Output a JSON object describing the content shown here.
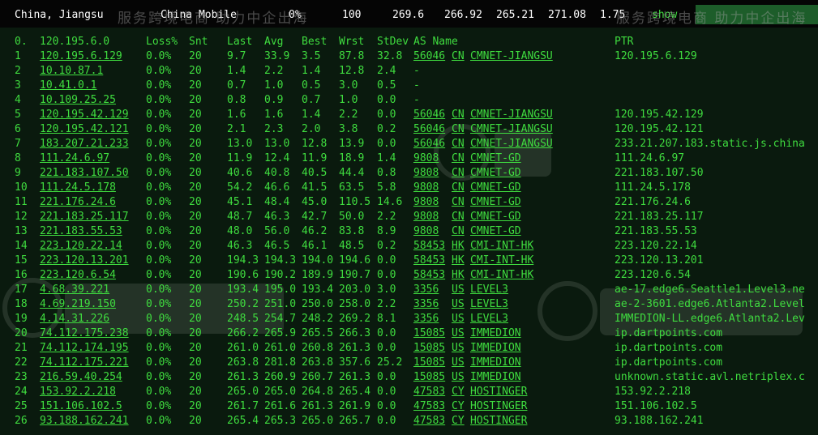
{
  "topbar": {
    "location": "China, Jiangsu",
    "isp": "China Mobile",
    "loss": "0%",
    "count": "100",
    "v1": "269.6",
    "v2": "266.92",
    "v3": "265.21",
    "v4": "271.08",
    "v5": "1.75",
    "show_label": "show"
  },
  "watermark": {
    "text_top": "服务跨境电商 助力中企出海"
  },
  "header": {
    "num": "0.",
    "host": "120.195.6.0",
    "loss": "Loss%",
    "snt": "Snt",
    "last": "Last",
    "avg": "Avg",
    "best": "Best",
    "wrst": "Wrst",
    "stdev": "StDev",
    "asname": "AS Name",
    "ptr": "PTR"
  },
  "rows": [
    {
      "n": "1",
      "host": "120.195.6.129",
      "loss": "0.0%",
      "snt": "20",
      "last": "9.7",
      "avg": "33.9",
      "best": "3.5",
      "wrst": "87.8",
      "stdev": "32.8",
      "as": "56046",
      "cc": "CN",
      "asname": "CMNET-JIANGSU",
      "ptr": "120.195.6.129"
    },
    {
      "n": "2",
      "host": "10.10.87.1",
      "loss": "0.0%",
      "snt": "20",
      "last": "1.4",
      "avg": "2.2",
      "best": "1.4",
      "wrst": "12.8",
      "stdev": "2.4",
      "as": "-",
      "cc": "",
      "asname": "",
      "ptr": ""
    },
    {
      "n": "3",
      "host": "10.41.0.1",
      "loss": "0.0%",
      "snt": "20",
      "last": "0.7",
      "avg": "1.0",
      "best": "0.5",
      "wrst": "3.0",
      "stdev": "0.5",
      "as": "-",
      "cc": "",
      "asname": "",
      "ptr": ""
    },
    {
      "n": "4",
      "host": "10.109.25.25",
      "loss": "0.0%",
      "snt": "20",
      "last": "0.8",
      "avg": "0.9",
      "best": "0.7",
      "wrst": "1.0",
      "stdev": "0.0",
      "as": "-",
      "cc": "",
      "asname": "",
      "ptr": ""
    },
    {
      "n": "5",
      "host": "120.195.42.129",
      "loss": "0.0%",
      "snt": "20",
      "last": "1.6",
      "avg": "1.6",
      "best": "1.4",
      "wrst": "2.2",
      "stdev": "0.0",
      "as": "56046",
      "cc": "CN",
      "asname": "CMNET-JIANGSU",
      "ptr": "120.195.42.129"
    },
    {
      "n": "6",
      "host": "120.195.42.121",
      "loss": "0.0%",
      "snt": "20",
      "last": "2.1",
      "avg": "2.3",
      "best": "2.0",
      "wrst": "3.8",
      "stdev": "0.2",
      "as": "56046",
      "cc": "CN",
      "asname": "CMNET-JIANGSU",
      "ptr": "120.195.42.121"
    },
    {
      "n": "7",
      "host": "183.207.21.233",
      "loss": "0.0%",
      "snt": "20",
      "last": "13.0",
      "avg": "13.0",
      "best": "12.8",
      "wrst": "13.9",
      "stdev": "0.0",
      "as": "56046",
      "cc": "CN",
      "asname": "CMNET-JIANGSU",
      "ptr": "233.21.207.183.static.js.china"
    },
    {
      "n": "8",
      "host": "111.24.6.97",
      "loss": "0.0%",
      "snt": "20",
      "last": "11.9",
      "avg": "12.4",
      "best": "11.9",
      "wrst": "18.9",
      "stdev": "1.4",
      "as": "9808",
      "cc": "CN",
      "asname": "CMNET-GD",
      "ptr": "111.24.6.97"
    },
    {
      "n": "9",
      "host": "221.183.107.50",
      "loss": "0.0%",
      "snt": "20",
      "last": "40.6",
      "avg": "40.8",
      "best": "40.5",
      "wrst": "44.4",
      "stdev": "0.8",
      "as": "9808",
      "cc": "CN",
      "asname": "CMNET-GD",
      "ptr": "221.183.107.50"
    },
    {
      "n": "10",
      "host": "111.24.5.178",
      "loss": "0.0%",
      "snt": "20",
      "last": "54.2",
      "avg": "46.6",
      "best": "41.5",
      "wrst": "63.5",
      "stdev": "5.8",
      "as": "9808",
      "cc": "CN",
      "asname": "CMNET-GD",
      "ptr": "111.24.5.178"
    },
    {
      "n": "11",
      "host": "221.176.24.6",
      "loss": "0.0%",
      "snt": "20",
      "last": "45.1",
      "avg": "48.4",
      "best": "45.0",
      "wrst": "110.5",
      "stdev": "14.6",
      "as": "9808",
      "cc": "CN",
      "asname": "CMNET-GD",
      "ptr": "221.176.24.6"
    },
    {
      "n": "12",
      "host": "221.183.25.117",
      "loss": "0.0%",
      "snt": "20",
      "last": "48.7",
      "avg": "46.3",
      "best": "42.7",
      "wrst": "50.0",
      "stdev": "2.2",
      "as": "9808",
      "cc": "CN",
      "asname": "CMNET-GD",
      "ptr": "221.183.25.117"
    },
    {
      "n": "13",
      "host": "221.183.55.53",
      "loss": "0.0%",
      "snt": "20",
      "last": "48.0",
      "avg": "56.0",
      "best": "46.2",
      "wrst": "83.8",
      "stdev": "8.9",
      "as": "9808",
      "cc": "CN",
      "asname": "CMNET-GD",
      "ptr": "221.183.55.53"
    },
    {
      "n": "14",
      "host": "223.120.22.14",
      "loss": "0.0%",
      "snt": "20",
      "last": "46.3",
      "avg": "46.5",
      "best": "46.1",
      "wrst": "48.5",
      "stdev": "0.2",
      "as": "58453",
      "cc": "HK",
      "asname": "CMI-INT-HK",
      "ptr": "223.120.22.14"
    },
    {
      "n": "15",
      "host": "223.120.13.201",
      "loss": "0.0%",
      "snt": "20",
      "last": "194.3",
      "avg": "194.3",
      "best": "194.0",
      "wrst": "194.6",
      "stdev": "0.0",
      "as": "58453",
      "cc": "HK",
      "asname": "CMI-INT-HK",
      "ptr": "223.120.13.201"
    },
    {
      "n": "16",
      "host": "223.120.6.54",
      "loss": "0.0%",
      "snt": "20",
      "last": "190.6",
      "avg": "190.2",
      "best": "189.9",
      "wrst": "190.7",
      "stdev": "0.0",
      "as": "58453",
      "cc": "HK",
      "asname": "CMI-INT-HK",
      "ptr": "223.120.6.54"
    },
    {
      "n": "17",
      "host": "4.68.39.221",
      "loss": "0.0%",
      "snt": "20",
      "last": "193.4",
      "avg": "195.0",
      "best": "193.4",
      "wrst": "203.0",
      "stdev": "3.0",
      "as": "3356",
      "cc": "US",
      "asname": "LEVEL3",
      "ptr": "ae-17.edge6.Seattle1.Level3.ne"
    },
    {
      "n": "18",
      "host": "4.69.219.150",
      "loss": "0.0%",
      "snt": "20",
      "last": "250.2",
      "avg": "251.0",
      "best": "250.0",
      "wrst": "258.0",
      "stdev": "2.2",
      "as": "3356",
      "cc": "US",
      "asname": "LEVEL3",
      "ptr": "ae-2-3601.edge6.Atlanta2.Level"
    },
    {
      "n": "19",
      "host": "4.14.31.226",
      "loss": "0.0%",
      "snt": "20",
      "last": "248.5",
      "avg": "254.7",
      "best": "248.2",
      "wrst": "269.2",
      "stdev": "8.1",
      "as": "3356",
      "cc": "US",
      "asname": "LEVEL3",
      "ptr": "IMMEDION-LL.edge6.Atlanta2.Lev"
    },
    {
      "n": "20",
      "host": "74.112.175.238",
      "loss": "0.0%",
      "snt": "20",
      "last": "266.2",
      "avg": "265.9",
      "best": "265.5",
      "wrst": "266.3",
      "stdev": "0.0",
      "as": "15085",
      "cc": "US",
      "asname": "IMMEDION",
      "ptr": "ip.dartpoints.com"
    },
    {
      "n": "21",
      "host": "74.112.174.195",
      "loss": "0.0%",
      "snt": "20",
      "last": "261.0",
      "avg": "261.0",
      "best": "260.8",
      "wrst": "261.3",
      "stdev": "0.0",
      "as": "15085",
      "cc": "US",
      "asname": "IMMEDION",
      "ptr": "ip.dartpoints.com"
    },
    {
      "n": "22",
      "host": "74.112.175.221",
      "loss": "0.0%",
      "snt": "20",
      "last": "263.8",
      "avg": "281.8",
      "best": "263.8",
      "wrst": "357.6",
      "stdev": "25.2",
      "as": "15085",
      "cc": "US",
      "asname": "IMMEDION",
      "ptr": "ip.dartpoints.com"
    },
    {
      "n": "23",
      "host": "216.59.40.254",
      "loss": "0.0%",
      "snt": "20",
      "last": "261.3",
      "avg": "260.9",
      "best": "260.7",
      "wrst": "261.3",
      "stdev": "0.0",
      "as": "15085",
      "cc": "US",
      "asname": "IMMEDION",
      "ptr": "unknown.static.avl.netriplex.c"
    },
    {
      "n": "24",
      "host": "153.92.2.218",
      "loss": "0.0%",
      "snt": "20",
      "last": "265.0",
      "avg": "265.0",
      "best": "264.8",
      "wrst": "265.4",
      "stdev": "0.0",
      "as": "47583",
      "cc": "CY",
      "asname": "HOSTINGER",
      "ptr": "153.92.2.218"
    },
    {
      "n": "25",
      "host": "151.106.102.5",
      "loss": "0.0%",
      "snt": "20",
      "last": "261.7",
      "avg": "261.6",
      "best": "261.3",
      "wrst": "261.9",
      "stdev": "0.0",
      "as": "47583",
      "cc": "CY",
      "asname": "HOSTINGER",
      "ptr": "151.106.102.5"
    },
    {
      "n": "26",
      "host": "93.188.162.241",
      "loss": "0.0%",
      "snt": "20",
      "last": "265.4",
      "avg": "265.3",
      "best": "265.0",
      "wrst": "265.7",
      "stdev": "0.0",
      "as": "47583",
      "cc": "CY",
      "asname": "HOSTINGER",
      "ptr": "93.188.162.241"
    }
  ]
}
